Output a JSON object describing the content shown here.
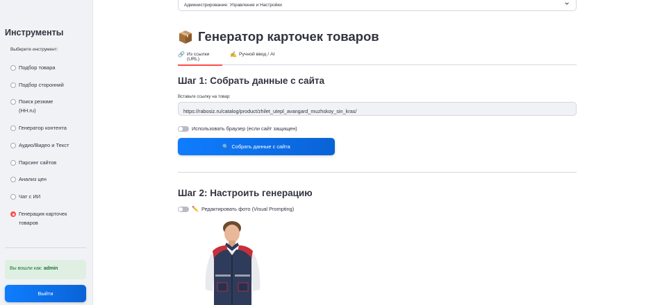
{
  "sidebar": {
    "title": "Инструменты",
    "subtitle": "Выберите инструмент:",
    "items": [
      {
        "label": "Подбор товара",
        "selected": false
      },
      {
        "label": "Подбор сторонний",
        "selected": false
      },
      {
        "label": "Поиск резюме (HH.ru)",
        "selected": false
      },
      {
        "label": "Генератор контента",
        "selected": false
      },
      {
        "label": "Аудио/Видео и Текст",
        "selected": false
      },
      {
        "label": "Парсинг сайтов",
        "selected": false
      },
      {
        "label": "Анализ цен",
        "selected": false
      },
      {
        "label": "Чат с ИИ",
        "selected": false
      },
      {
        "label": "Генерация карточек товаров",
        "selected": true
      }
    ],
    "login_prefix": "Вы вошли как:",
    "login_user": "admin",
    "logout_label": "Выйти"
  },
  "main": {
    "select_value": "Администрирование: Управление и Настройки",
    "page_title": "Генератор карточек товаров",
    "tabs": [
      {
        "icon": "🔗",
        "label": "Из ссылки (URL)",
        "active": true
      },
      {
        "icon": "✍️",
        "label": "Ручной ввод / AI",
        "active": false
      }
    ],
    "step1_title": "Шаг 1: Собрать данные с сайта",
    "url_label": "Вставьте ссылку на товар:",
    "url_value": "https://rabosiz.ru/catalog/product/zhilet_utepl_avangard_muzhskoy_sin_kras/",
    "browser_toggle_label": "Использовать браузер (если сайт защищен)",
    "collect_button_label": "Собрать данные с сайта",
    "step2_title": "Шаг 2: Настроить генерацию",
    "edit_photo_toggle_label": "Редактировать фото (Visual Prompting)"
  },
  "colors": {
    "accent": "#ff4b4b",
    "primary_button": "#0f7dff",
    "sidebar_bg": "#f0f2f6",
    "success_bg": "#dff0e3",
    "success_text": "#177233"
  }
}
